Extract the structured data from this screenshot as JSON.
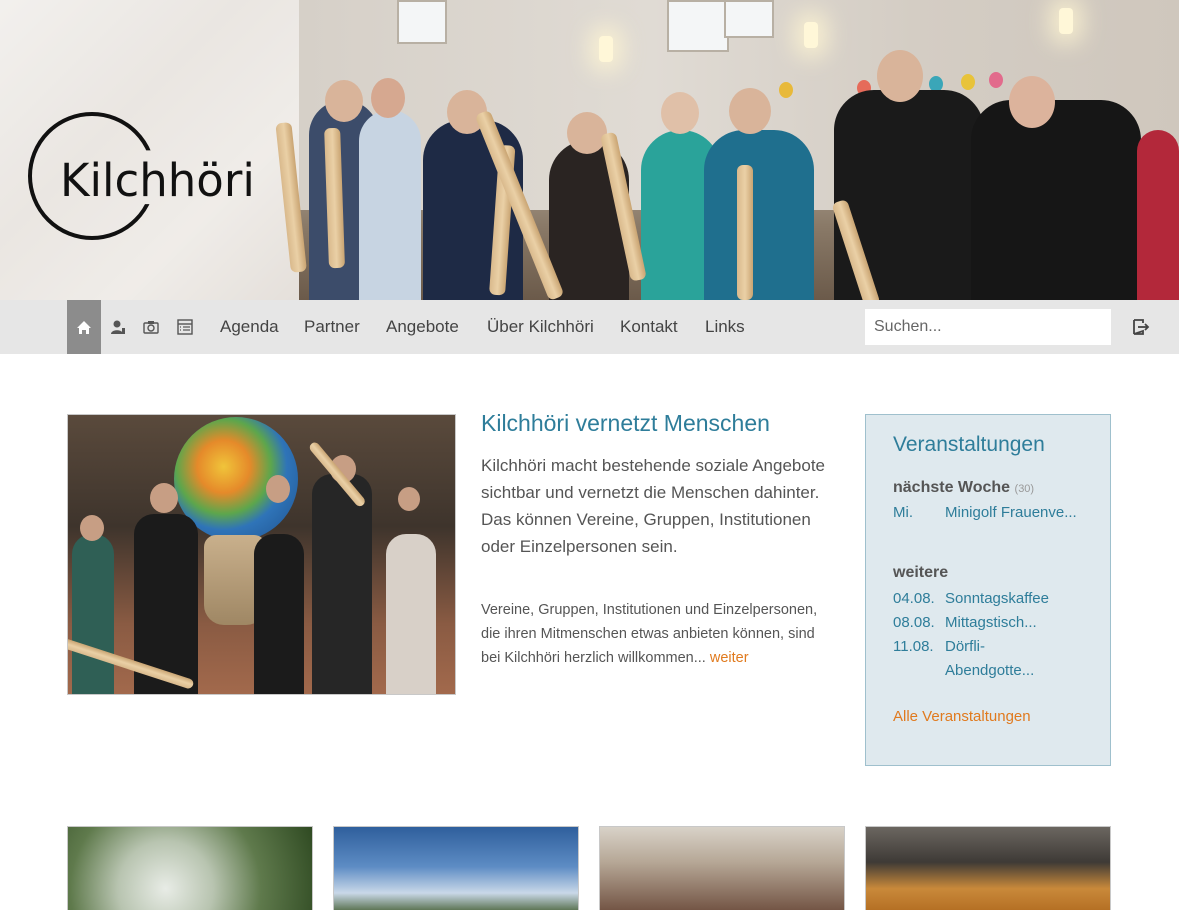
{
  "brand": {
    "logo_text": "Kilchhöri"
  },
  "nav": {
    "items": [
      {
        "label": "Agenda"
      },
      {
        "label": "Partner"
      },
      {
        "label": "Angebote"
      },
      {
        "label": "Über Kilchhöri"
      },
      {
        "label": "Kontakt"
      },
      {
        "label": "Links"
      }
    ],
    "icons": [
      "home-icon",
      "person-icon",
      "camera-icon",
      "list-icon"
    ],
    "search_placeholder": "Suchen...",
    "logout_icon": "logout-icon"
  },
  "feature": {
    "title": "Kilchhöri vernetzt Menschen",
    "lead": "Kilchhöri macht bestehende soziale Angebote sichtbar und vernetzt die Menschen dahinter. Das können Vereine, Gruppen, Institutionen oder Einzelpersonen sein.",
    "body": "Vereine, Gruppen, Institutionen und Einzelpersonen, die ihren Mitmenschen etwas anbieten können, sind bei Kilchhöri herzlich willkommen...",
    "more_label": "weiter"
  },
  "events": {
    "title": "Veranstaltungen",
    "next_week": {
      "label": "nächste Woche",
      "count": "(30)",
      "items": [
        {
          "date": "Mi.",
          "name": "Minigolf Frauenve..."
        }
      ]
    },
    "further": {
      "label": "weitere",
      "items": [
        {
          "date": "04.08.",
          "name": "Sonntagskaffee"
        },
        {
          "date": "08.08.",
          "name": "Mittagstisch..."
        },
        {
          "date": "11.08.",
          "name": "Dörfli-Abendgotte..."
        }
      ]
    },
    "all_label": "Alle Veranstaltungen"
  },
  "colors": {
    "accent": "#2e7d9a",
    "link_orange": "#e07a1e",
    "nav_bg": "#e6e6e6",
    "events_bg": "#dfe9ee"
  }
}
